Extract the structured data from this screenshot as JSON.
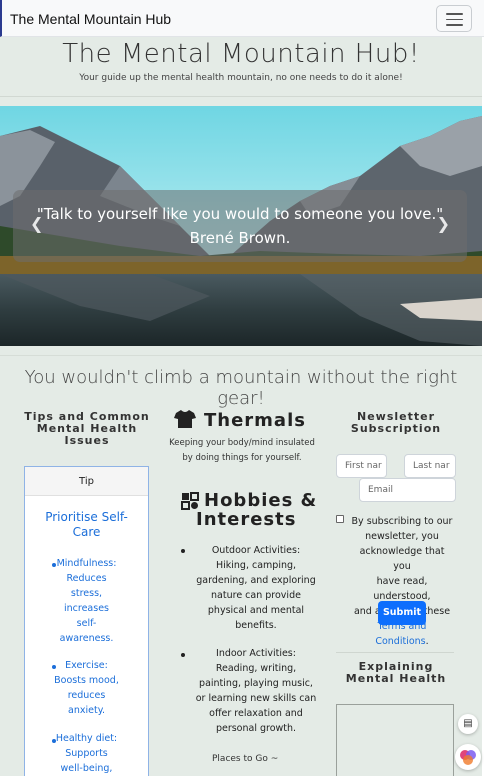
{
  "navbar": {
    "brand": "The Mental Mountain Hub",
    "toggle_icon": "hamburger-menu-icon"
  },
  "hero": {
    "title": "The Mental Mountain Hub!",
    "subtitle": "Your guide up the mental health mountain, no one needs to do it alone!"
  },
  "carousel": {
    "quote_line1": "\"Talk to yourself like you would to someone you love.\"",
    "quote_line2": "Brené Brown.",
    "prev_icon": "chevron-left-icon",
    "next_icon": "chevron-right-icon"
  },
  "tagline": "You wouldn't climb a mountain without the right gear!",
  "tips": {
    "heading_lines": [
      "Tips and Common",
      "Mental Health",
      "Issues"
    ],
    "card_header": "Tip",
    "card_title_lines": [
      "Prioritise Self-",
      "Care"
    ],
    "items": [
      {
        "lines": [
          "Mindfulness:",
          "Reduces",
          "stress,",
          "increases",
          "self-",
          "awareness."
        ]
      },
      {
        "lines": [
          "Exercise:",
          "Boosts mood,",
          "reduces",
          "anxiety."
        ]
      },
      {
        "lines": [
          "Healthy diet:",
          "Supports",
          "well-being,"
        ]
      }
    ]
  },
  "middle": {
    "thermals_icon": "tshirt-icon",
    "thermals_title": "Thermals",
    "thermals_sub_lines": [
      "Keeping your body/mind insulated",
      "by doing things for yourself."
    ],
    "hobbies_icon": "puzzle-icon",
    "hobbies_title_lines": [
      "Hobbies &",
      "Interests"
    ],
    "items": [
      {
        "lines": [
          "Outdoor Activities:",
          "Hiking, camping,",
          "gardening, and exploring",
          "nature can provide",
          "physical and mental",
          "benefits."
        ]
      },
      {
        "lines": [
          "Indoor Activities:",
          "Reading, writing,",
          "painting, playing music,",
          "or learning new skills can",
          "offer relaxation and",
          "personal growth."
        ]
      }
    ],
    "places": "Places to Go ~"
  },
  "newsletter": {
    "heading_lines": [
      "Newsletter",
      "Subscription"
    ],
    "first_name_placeholder": "First nar",
    "last_name_placeholder": "Last nar",
    "email_placeholder": "Email",
    "terms_lines": [
      "By subscribing to our",
      "newsletter, you",
      "acknowledge that you",
      "have read, understood,",
      "and agreed to these"
    ],
    "terms_link": "Terms and Conditions",
    "terms_end": ".",
    "submit_label": "Submit",
    "explaining_lines": [
      "Explaining",
      "Mental Health"
    ]
  },
  "colors": {
    "page_bg": "#e4ebe6",
    "link_blue": "#1b6ed9",
    "button_blue": "#0d6efd"
  }
}
